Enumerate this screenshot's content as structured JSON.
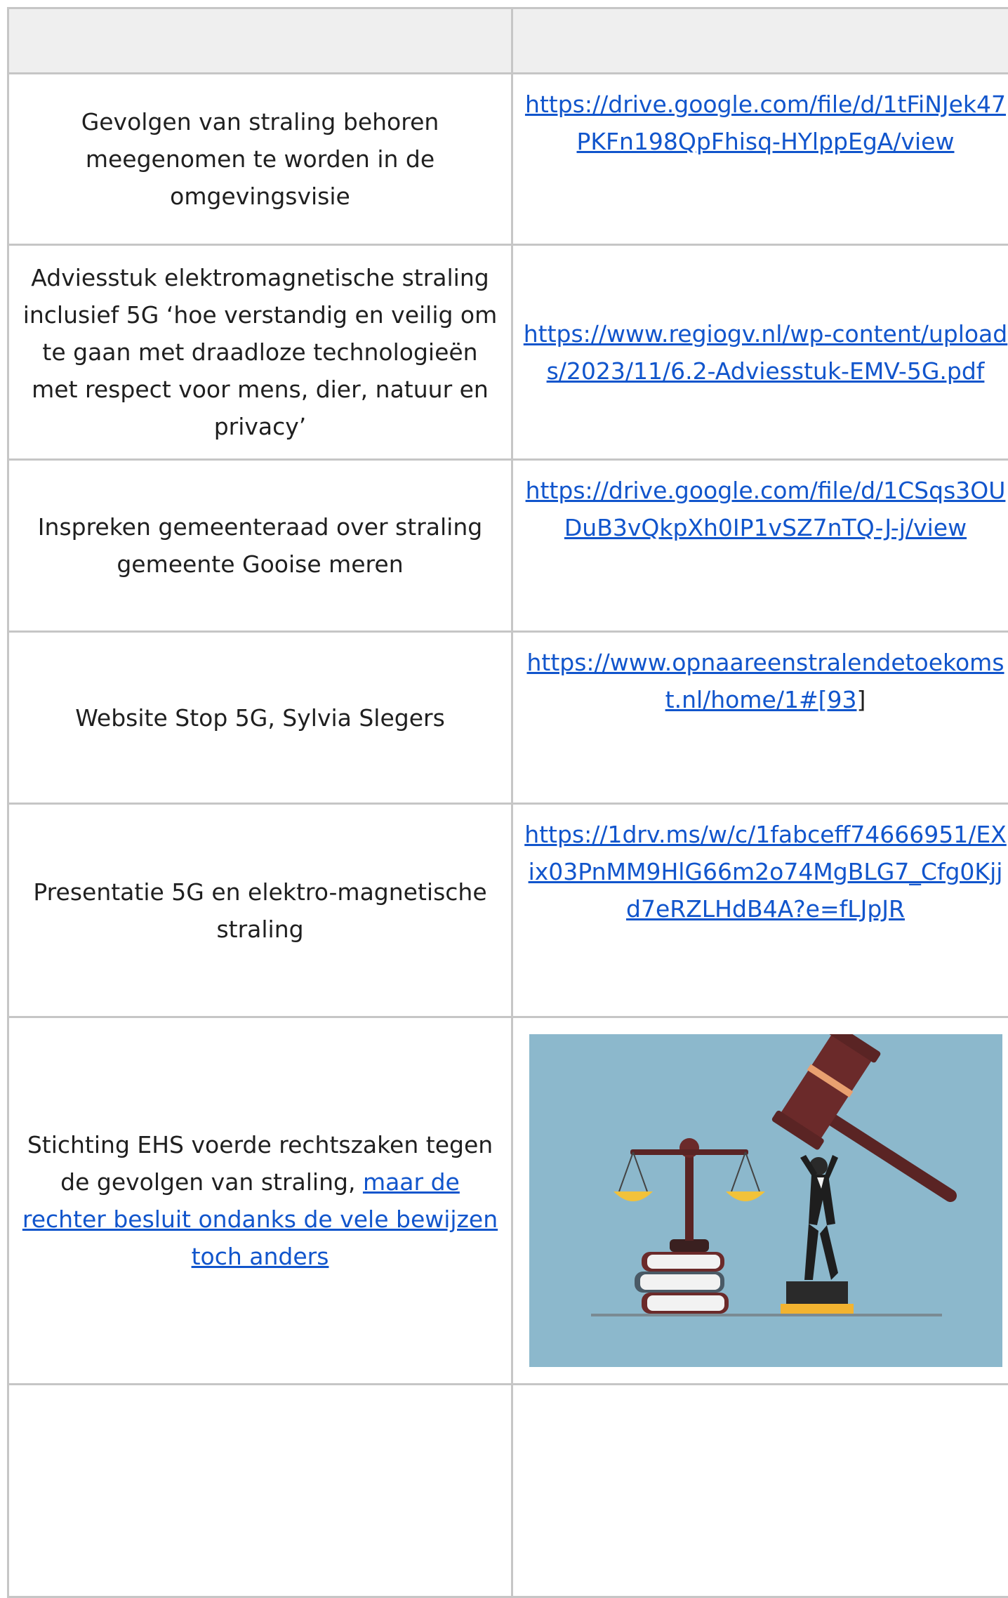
{
  "table": {
    "header": [
      "",
      ""
    ],
    "rows": [
      {
        "description": "Gevolgen van straling behoren meegenomen te worden in de omgevingsvisie",
        "link": "https://drive.google.com/file/d/1tFiNJek47PKFn198QpFhisq-HYlppEgA/view"
      },
      {
        "description": "Adviesstuk elektromagnetische straling inclusief 5G ‘hoe verstandig en veilig om te gaan met draadloze technologieën met respect voor mens, dier, natuur en privacy’",
        "link": "https://www.regiogv.nl/wp-content/uploads/2023/11/6.2-Adviesstuk-EMV-5G.pdf"
      },
      {
        "description": "Inspreken gemeenteraad over straling gemeente Gooise meren",
        "link": "https://drive.google.com/file/d/1CSqs3OUDuB3vQkpXh0IP1vSZ7nTQ-J-j/view"
      },
      {
        "description": "Website Stop 5G, Sylvia Slegers",
        "link": "https://www.opnaareenstralendetoekomst.nl/home/1#",
        "footnote": "[93",
        "footnote_close": "]"
      },
      {
        "description": "Presentatie 5G en elektro-magnetische straling",
        "link": "https://1drv.ms/w/c/1fabceff74666951/EXix03PnMM9HlG66m2o74MgBLG7_Cfg0Kjjd7eRZLHdB4A?e=fLJpJR"
      },
      {
        "description_prefix": "Stichting EHS voerde rechtszaken tegen de gevolgen van straling, ",
        "description_link": "maar de rechter besluit ondanks de vele bewijzen toch anders ",
        "image_icon": "gavel-scales-justice-illustration"
      },
      {
        "description": "",
        "link": ""
      }
    ]
  },
  "colors": {
    "border": "#c6c6c6",
    "header_bg": "#efefef",
    "link": "#1155cc",
    "illustration_bg": "#8cb8cc"
  }
}
